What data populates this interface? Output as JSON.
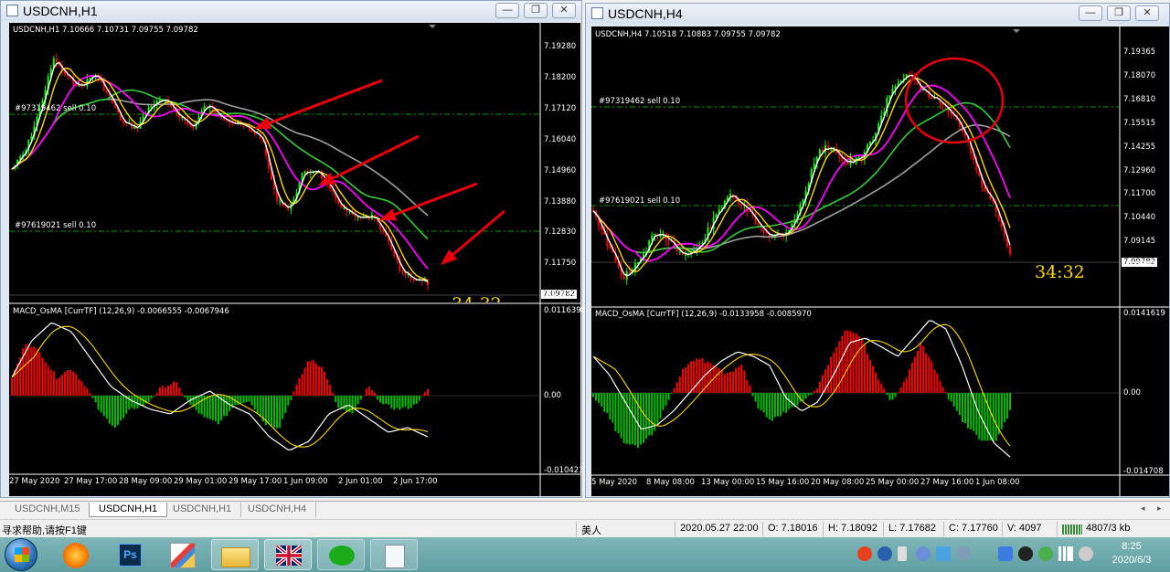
{
  "h1": {
    "title": "USDCNH,H1",
    "info": "USDCNH,H1  7.10666 7.10731 7.09755 7.09782",
    "order_upper": "#97319462 sell 0.10",
    "order_lower": "#97619021 sell 0.10",
    "price_scale": [
      "7.19280",
      "7.18200",
      "7.17120",
      "7.16040",
      "7.14960",
      "7.13880",
      "7.12830",
      "7.11750",
      "7.10670"
    ],
    "current_price": "7.09782",
    "timer": "34:32",
    "macd_label": "MACD_OsMA [CurrTF] (12,26,9) -0.0066555 -0.0067946",
    "macd_scale": [
      "0.0116398",
      "0.00",
      "-0.0104231"
    ],
    "time_axis": [
      "27 May 2020",
      "27 May 17:00",
      "28 May 09:00",
      "29 May 01:00",
      "29 May 17:00",
      "1 Jun 09:00",
      "2 Jun 01:00",
      "2 Jun 17:00"
    ]
  },
  "h4": {
    "title": "USDCNH,H4",
    "info": "USDCNH,H4  7.10518 7.10883 7.09755 7.09782",
    "order_upper": "#97319462 sell 0.10",
    "order_lower": "#97619021 sell 0.10",
    "price_scale": [
      "7.19365",
      "7.18070",
      "7.16810",
      "7.15515",
      "7.14255",
      "7.12960",
      "7.11700",
      "7.10440",
      "7.09145",
      "7.07885"
    ],
    "current_price": "7.09782",
    "timer": "34:32",
    "macd_label": "MACD_OsMA [CurrTF] (12,26,9) -0.0133958 -0.0085970",
    "macd_scale": [
      "0.0141619",
      "0.00",
      "-0.014708"
    ],
    "time_axis": [
      "5 May 2020",
      "8 May 08:00",
      "13 May 00:00",
      "15 May 16:00",
      "20 May 08:00",
      "25 May 00:00",
      "27 May 16:00",
      "1 Jun 08:00"
    ]
  },
  "tabs": [
    "USDCNH,M15",
    "USDCNH,H1",
    "USDCNH,H1",
    "USDCNH,H4"
  ],
  "active_tab": 1,
  "status": {
    "help": "寻求帮助,请按F1键",
    "profile": "美人",
    "datetime": "2020.05.27 22:00",
    "open": "O: 7.18016",
    "high": "H: 7.18092",
    "low": "L: 7.17682",
    "close": "C: 7.17760",
    "volume": "V: 4097",
    "traffic": "4807/3 kb"
  },
  "taskbar": {
    "time": "8:25",
    "date": "2020/6/3",
    "apps": [
      "start-button",
      "browser",
      "photoshop",
      "paint",
      "file-explorer",
      "metatrader",
      "wechat",
      "notepad"
    ]
  },
  "colors": {
    "bull_candle": "#00ff00",
    "bear_candle": "#ff0000",
    "macd_pos": "#ff0000",
    "macd_neg": "#00c000",
    "order_line": "#00a000",
    "ma_white": "#ffffff",
    "ma_yellow": "#ffd700",
    "ma_magenta": "#ff00ff",
    "ma_green": "#32cd32",
    "ma_gray": "#a0a0a0",
    "annotation_red": "#e8000d",
    "timer_gold": "#ffd700"
  }
}
